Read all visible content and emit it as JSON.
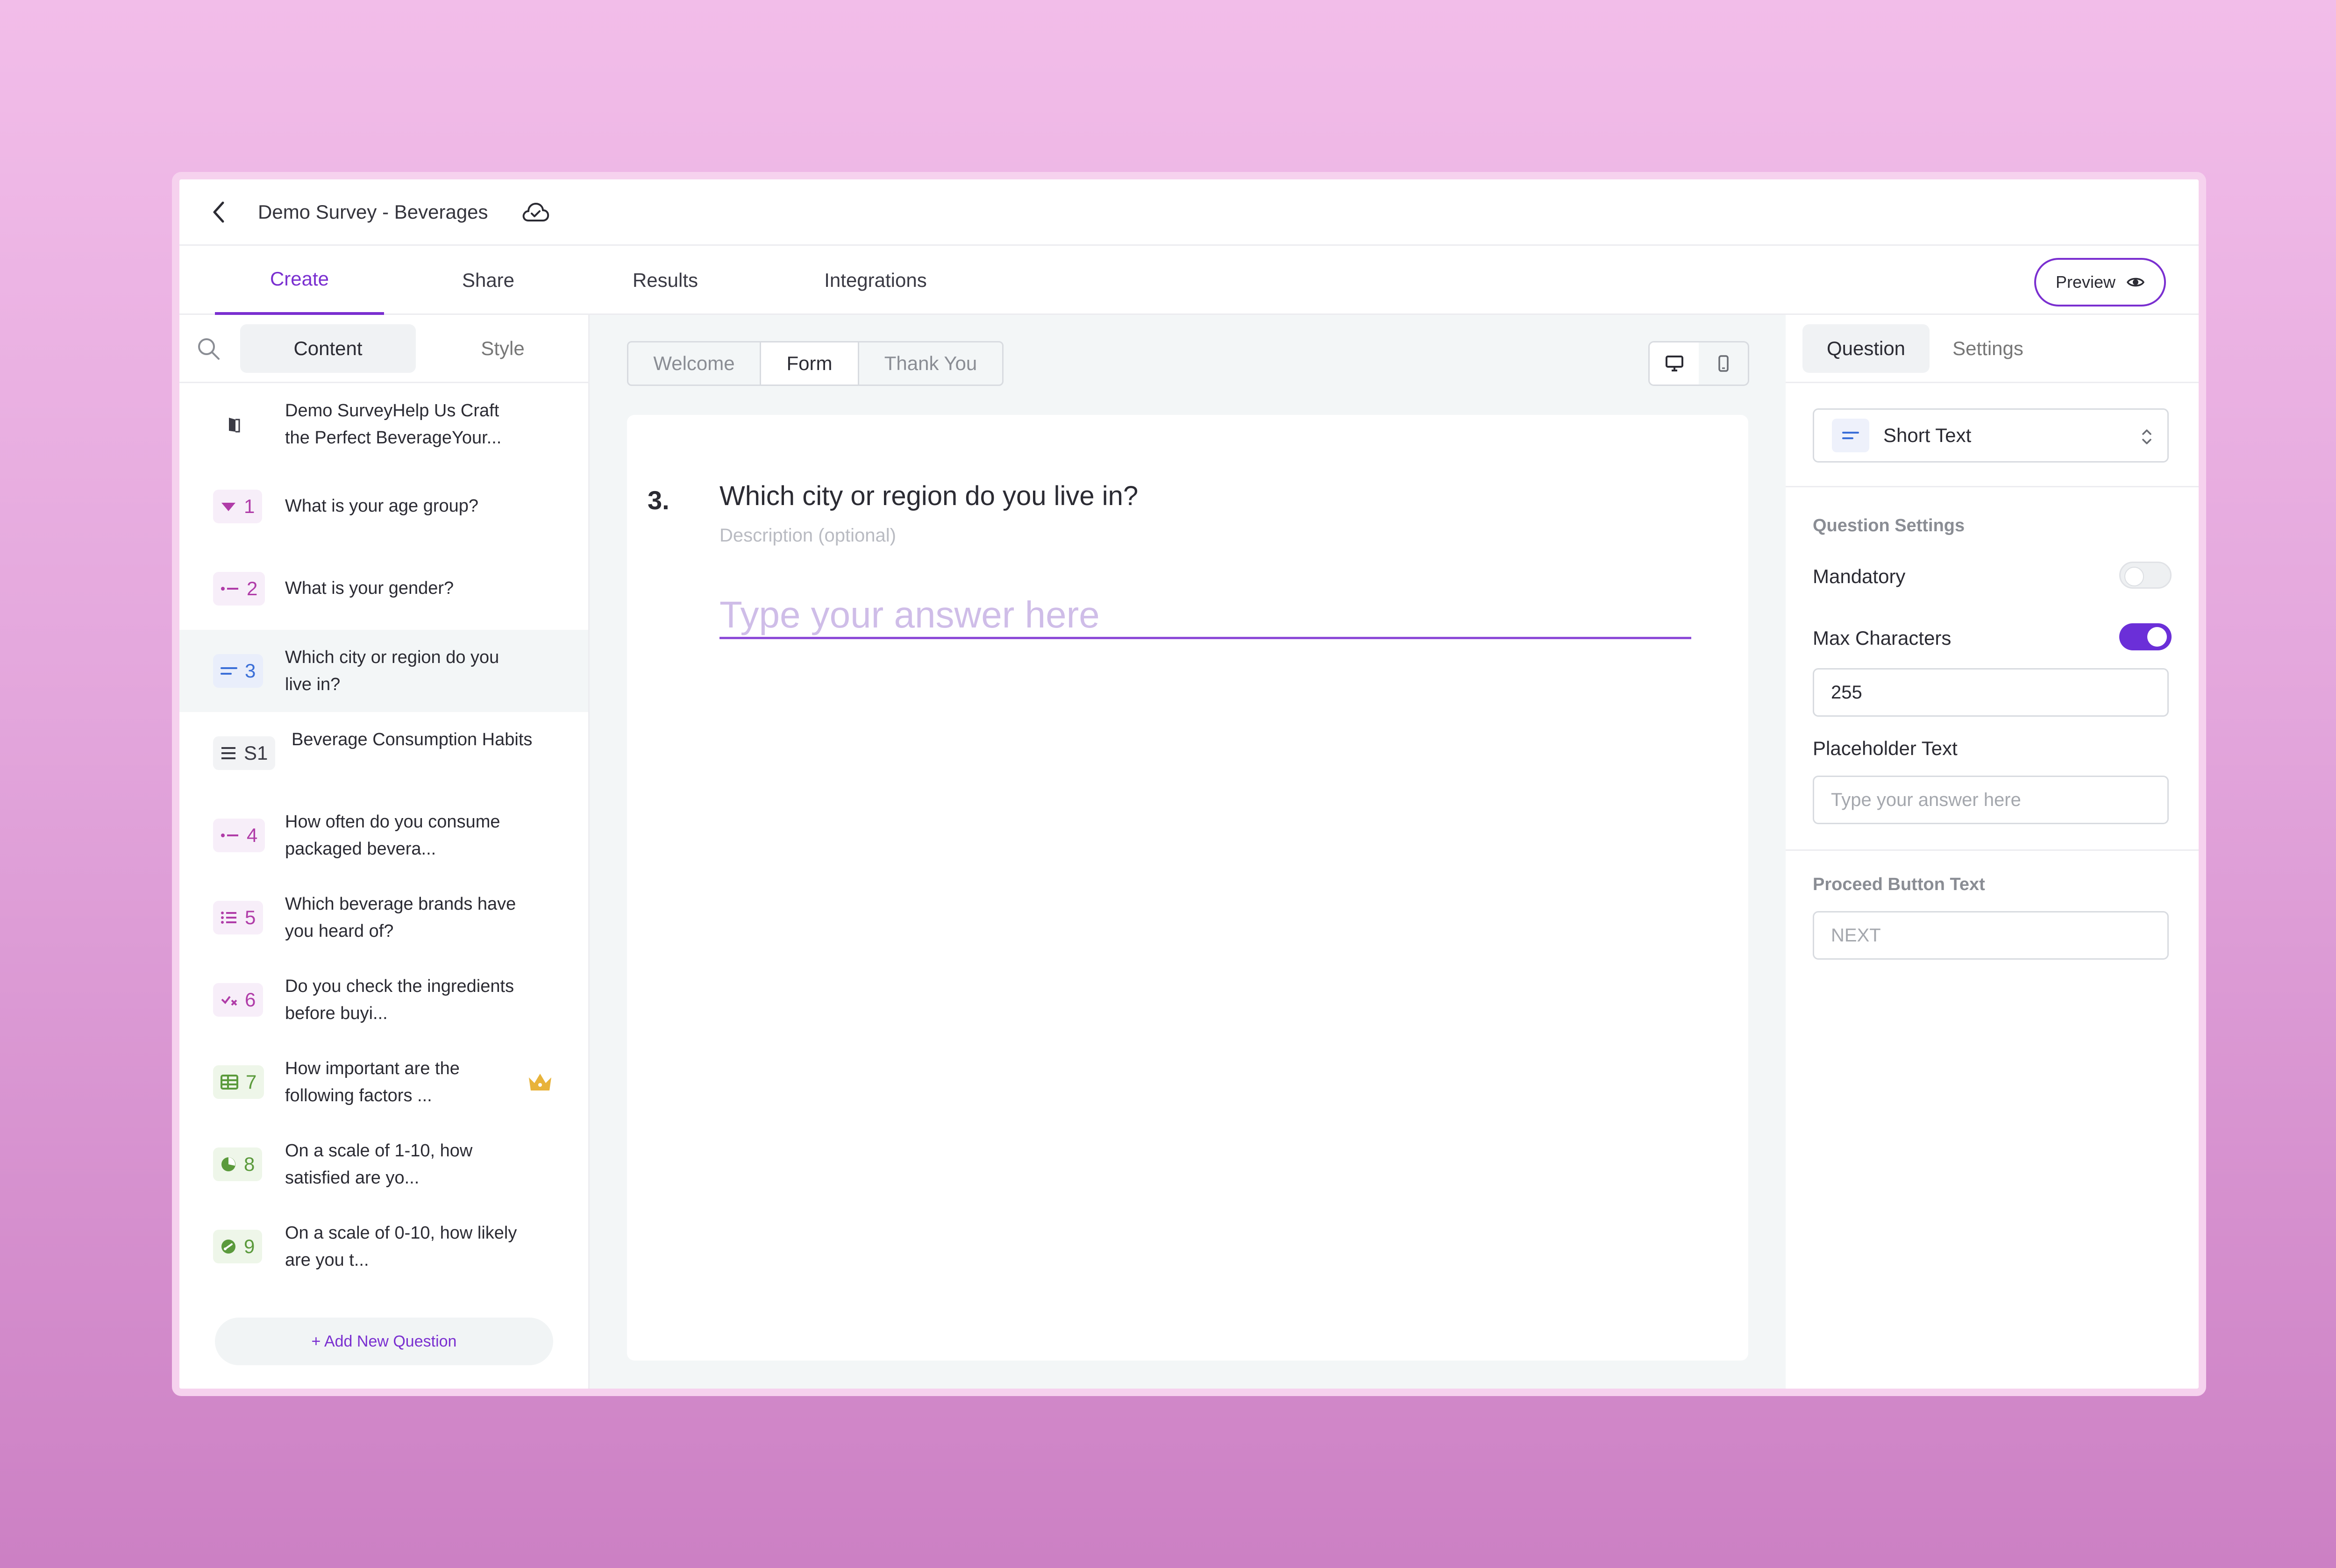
{
  "header": {
    "survey_title": "Demo Survey - Beverages"
  },
  "tabs": [
    {
      "label": "Create"
    },
    {
      "label": "Share"
    },
    {
      "label": "Results"
    },
    {
      "label": "Integrations"
    }
  ],
  "preview_label": "Preview",
  "left": {
    "segments": {
      "content": "Content",
      "style": "Style"
    },
    "items": [
      {
        "badge": "",
        "text": "Demo SurveyHelp Us Craft the Perfect BeverageYour...",
        "icon": "door-icon"
      },
      {
        "badge": "1",
        "text": "What is your age group?",
        "icon": "dropdown-icon"
      },
      {
        "badge": "2",
        "text": "What is your gender?",
        "icon": "single-choice-icon"
      },
      {
        "badge": "3",
        "text": "Which city or region do you live in?",
        "icon": "short-text-icon"
      },
      {
        "badge": "S1",
        "text": "Beverage Consumption Habits",
        "icon": "section-icon"
      },
      {
        "badge": "4",
        "text": "How often do you consume packaged bevera...",
        "icon": "single-choice-icon"
      },
      {
        "badge": "5",
        "text": "Which beverage brands have you heard of?",
        "icon": "list-icon"
      },
      {
        "badge": "6",
        "text": "Do you check the ingredients before buyi...",
        "icon": "yes-no-icon"
      },
      {
        "badge": "7",
        "text": "How important are the following factors ...",
        "icon": "matrix-icon"
      },
      {
        "badge": "8",
        "text": "On a scale of 1-10, how satisfied are yo...",
        "icon": "rating-icon"
      },
      {
        "badge": "9",
        "text": "On a scale of 0-10, how likely are you t...",
        "icon": "nps-icon"
      }
    ],
    "add_question": "+ Add New Question"
  },
  "center": {
    "view_tabs": [
      "Welcome",
      "Form",
      "Thank You"
    ],
    "question": {
      "number": "3.",
      "title": "Which city or region do you live in?",
      "description": "Description (optional)",
      "answer_placeholder": "Type your answer here"
    }
  },
  "right": {
    "tabs": {
      "question": "Question",
      "settings": "Settings"
    },
    "type": "Short Text",
    "section_title": "Question Settings",
    "mandatory_label": "Mandatory",
    "mandatory": false,
    "max_chars_label": "Max Characters",
    "max_chars_enabled": true,
    "max_chars_value": "255",
    "placeholder_label": "Placeholder Text",
    "placeholder_value": "Type your answer here",
    "proceed_label": "Proceed Button Text",
    "proceed_value": "NEXT"
  },
  "colors": {
    "accent": "#7a2fd0",
    "toggle_on": "#6b2fd8",
    "gold": "#e8b33a",
    "green": "#6aa84f"
  }
}
